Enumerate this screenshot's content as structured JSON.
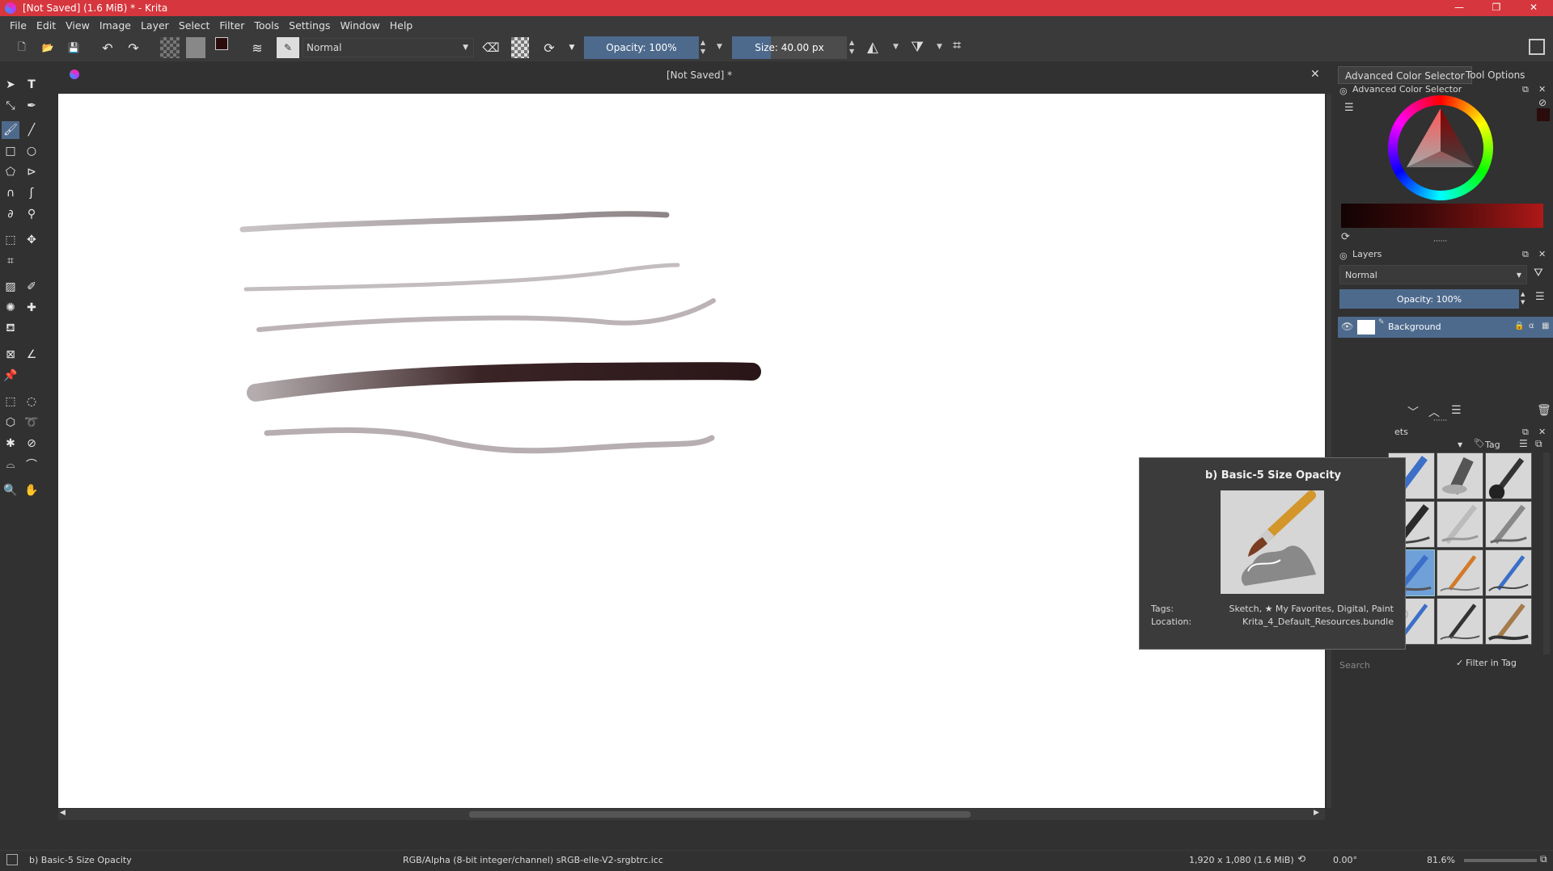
{
  "window": {
    "title": "[Not Saved]  (1.6 MiB)  * - Krita"
  },
  "menu": [
    "File",
    "Edit",
    "View",
    "Image",
    "Layer",
    "Select",
    "Filter",
    "Tools",
    "Settings",
    "Window",
    "Help"
  ],
  "toolbar": {
    "blend_mode": "Normal",
    "opacity_label": "Opacity: 100%",
    "opacity_value": 1.0,
    "size_label": "Size: 40.00 px"
  },
  "document_tab": {
    "title": "[Not Saved]  *"
  },
  "dock": {
    "tab_color": "Advanced Color Selector",
    "tab_tool_options": "Tool Options",
    "color_selector_title": "Advanced Color Selector",
    "layers_title": "Layers",
    "layers_blend": "Normal",
    "layers_opacity": "Opacity:  100%",
    "layer_name": "Background",
    "presets_title_partial": "ets",
    "tag_label": "Tag",
    "search_placeholder": "Search",
    "filter_in_tag": "Filter in Tag"
  },
  "tooltip": {
    "title": "b) Basic-5 Size Opacity",
    "tags_label": "Tags:",
    "tags_value": "Sketch, ★ My Favorites, Digital, Paint",
    "location_label": "Location:",
    "location_value": "Krita_4_Default_Resources.bundle"
  },
  "status": {
    "brush": "b) Basic-5 Size Opacity",
    "color_space": "RGB/Alpha (8-bit integer/channel)  sRGB-elle-V2-srgbtrc.icc",
    "dimensions": "1,920 x 1,080 (1.6 MiB)",
    "rotation": "0.00°",
    "zoom": "81.6%"
  },
  "colors": {
    "titlebar": "#d6363d",
    "dark_bg": "#313131",
    "panel_bg": "#3a3a3a",
    "accent_blue": "#4d6a8d",
    "stroke_light": "#bdb5b8",
    "stroke_dark": "#2a1618"
  }
}
